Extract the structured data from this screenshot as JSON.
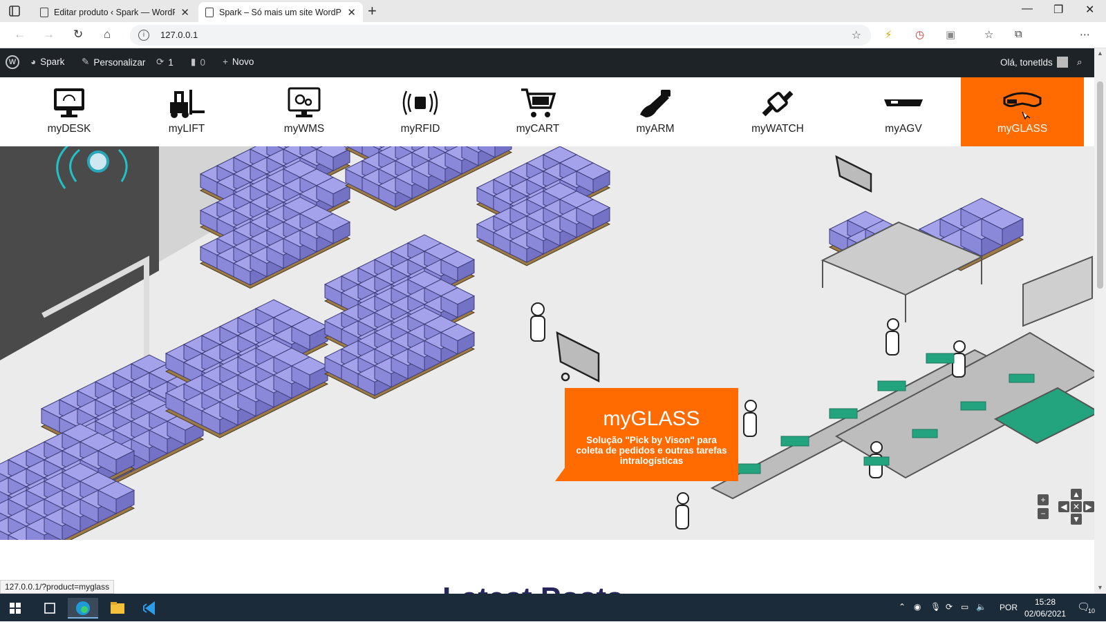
{
  "browser": {
    "tabs": [
      {
        "title": "Editar produto ‹ Spark — WordPress"
      },
      {
        "title": "Spark – Só mais um site WordPress"
      }
    ],
    "url": "127.0.0.1"
  },
  "wpbar": {
    "site": "Spark",
    "customize": "Personalizar",
    "updates": "1",
    "comments": "0",
    "new": "Novo",
    "greeting": "Olá, tonetlds"
  },
  "products": [
    {
      "label": "myDESK",
      "icon": "monitor-icon"
    },
    {
      "label": "myLIFT",
      "icon": "forklift-icon"
    },
    {
      "label": "myWMS",
      "icon": "wms-screen-icon"
    },
    {
      "label": "myRFID",
      "icon": "rfid-icon"
    },
    {
      "label": "myCART",
      "icon": "cart-icon"
    },
    {
      "label": "myARM",
      "icon": "arm-icon"
    },
    {
      "label": "myWATCH",
      "icon": "watch-icon"
    },
    {
      "label": "myAGV",
      "icon": "agv-icon"
    },
    {
      "label": "myGLASS",
      "icon": "glass-icon",
      "active": true
    }
  ],
  "callout": {
    "title": "myGLASS",
    "text": "Solução \"Pick by Vison\" para coleta de pedidos e outras tarefas intralogísticas"
  },
  "map_controls": {
    "zoom_in": "+",
    "zoom_out": "−"
  },
  "below": {
    "heading": "Latest Posts"
  },
  "status_url": "127.0.0.1/?product=myglass",
  "taskbar": {
    "lang": "POR",
    "time": "15:28",
    "date": "02/06/2021",
    "notifications": "10"
  },
  "colors": {
    "accent": "#ff6b00",
    "wpbar": "#1d2327",
    "box": "#8a88d8",
    "heading": "#26265a"
  }
}
